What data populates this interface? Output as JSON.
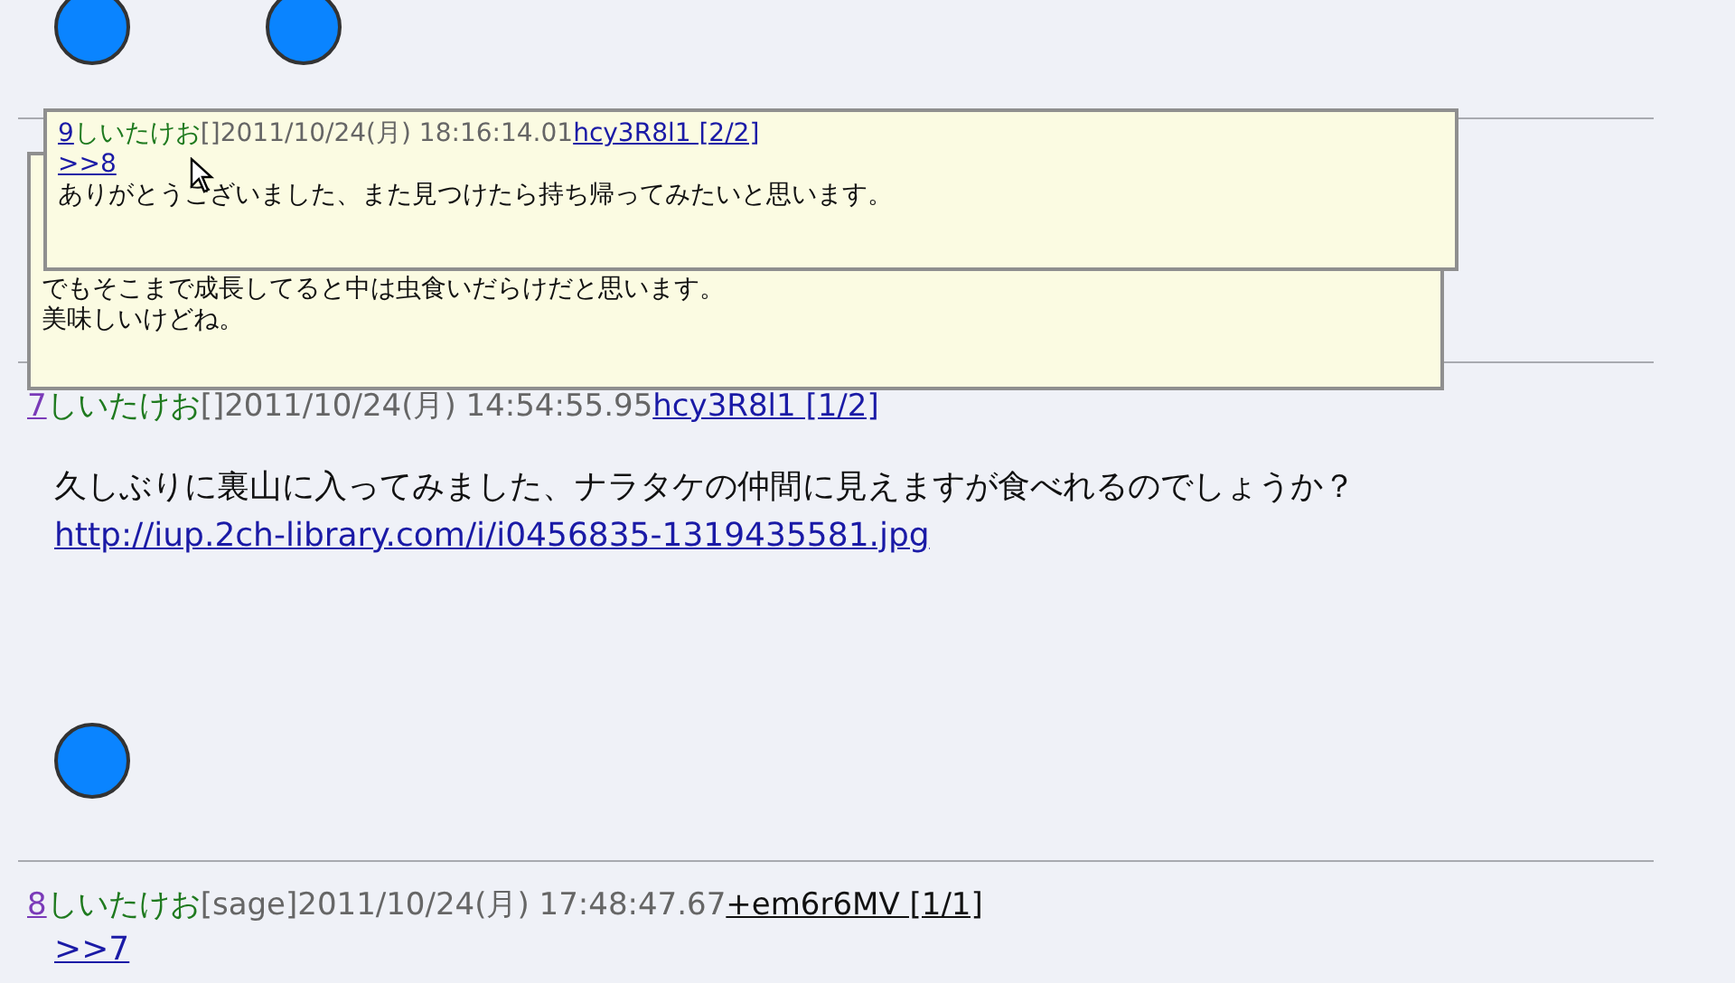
{
  "posts": [
    {
      "number": "7",
      "visited": true,
      "name": "しいたけお",
      "mail": "[]",
      "date": "2011/10/24(月) 14:54:55.95",
      "id": "hcy3R8l1 [1/2]",
      "id_linked": true,
      "lines": [
        {
          "kind": "text",
          "text": "久しぶりに裏山に入ってみました、ナラタケの仲間に見えますが食べれるのでしょうか？"
        },
        {
          "kind": "link",
          "text": "http://iup.2ch-library.com/i/i0456835-1319435581.jpg"
        }
      ]
    },
    {
      "number": "8",
      "visited": true,
      "name": "しいたけお",
      "mail": "[sage]",
      "date": "2011/10/24(月) 17:48:47.67",
      "id": "+em6r6MV [1/1]",
      "id_linked": false,
      "lines": [
        {
          "kind": "link",
          "text": ">>7"
        }
      ]
    }
  ],
  "popups": [
    {
      "header": {
        "number": "9",
        "visited": false,
        "name": "しいたけお",
        "mail": "[]",
        "date": "2011/10/24(月) 18:16:14.01",
        "id": "hcy3R8l1 [2/2]",
        "id_linked": true
      },
      "lines": [
        {
          "kind": "link",
          "text": ">>8"
        },
        {
          "kind": "text",
          "text": "ありがとうございました、また見つけたら持ち帰ってみたいと思います。"
        }
      ]
    },
    {
      "lines": [
        {
          "kind": "text",
          "text": "でもそこまで成長してると中は虫食いだらけだと思います。"
        },
        {
          "kind": "text",
          "text": "美味しいけどね。"
        }
      ]
    }
  ]
}
